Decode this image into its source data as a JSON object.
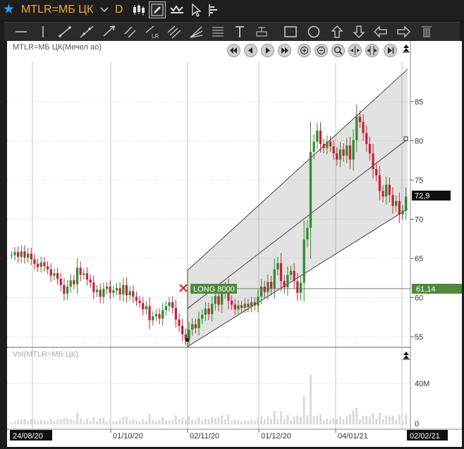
{
  "toolbar": {
    "symbol": "MTLR=МБ ЦК",
    "timeframe": "D"
  },
  "chart_header": {
    "price_title": "MTLR=МБ ЦК(Мечел ао)",
    "volume_title": "Vol(MTLR=МБ ЦК)"
  },
  "price_axis": {
    "ticks": [
      "85",
      "80",
      "75",
      "70",
      "65",
      "60",
      "55"
    ],
    "last_price_label": "72,9",
    "order_price_label": "61,14"
  },
  "volume_axis": {
    "ticks": [
      "40M",
      "0"
    ]
  },
  "order": {
    "label": "LONG 8000"
  },
  "date_axis": {
    "start_label": "24/08/20",
    "ticks": [
      "01/10/20",
      "02/11/20",
      "01/12/20",
      "04/01/21"
    ],
    "end_label": "02/02/21"
  },
  "colors": {
    "up": "#2e8b2e",
    "down": "#c8203a",
    "accent": "#f0a838",
    "star": "#2d9cf0",
    "order_label": "#4f8a3a"
  },
  "chart_data": {
    "type": "candlestick",
    "x_range": [
      "24/08/20",
      "02/02/21"
    ],
    "ylim": [
      53,
      91
    ],
    "price_ticks": [
      85,
      80,
      75,
      70,
      65,
      60,
      55
    ],
    "last_price": 72.9,
    "order_price": 61.14,
    "volume_ticks": [
      "40M",
      "0"
    ],
    "grid": true,
    "closes": [
      65.4,
      65.8,
      65.2,
      65.9,
      65.1,
      65.6,
      64.9,
      64.3,
      63.9,
      64.5,
      64.0,
      63.6,
      62.8,
      63.1,
      62.4,
      61.6,
      60.5,
      61.4,
      62.2,
      61.7,
      63.8,
      62.9,
      63.1,
      62.3,
      61.9,
      60.7,
      61.0,
      60.1,
      61.1,
      61.4,
      60.6,
      60.9,
      61.2,
      60.4,
      61.6,
      60.3,
      60.8,
      60.1,
      59.6,
      59.3,
      58.5,
      58.9,
      57.1,
      57.6,
      57.9,
      57.3,
      58.4,
      58.9,
      59.4,
      58.7,
      57.2,
      56.4,
      55.3,
      54.6,
      55.9,
      56.6,
      56.1,
      57.3,
      57.8,
      58.6,
      57.9,
      59.2,
      60.2,
      59.1,
      60.6,
      61.3,
      59.6,
      59.1,
      58.5,
      59.0,
      58.7,
      59.2,
      58.8,
      59.4,
      59.0,
      60.1,
      61.4,
      60.7,
      62.0,
      61.2,
      63.6,
      64.4,
      62.1,
      61.3,
      62.9,
      63.4,
      62.1,
      60.6,
      61.9,
      67.4,
      68.9,
      78.6,
      79.9,
      81.3,
      79.6,
      79.1,
      79.9,
      79.3,
      78.4,
      77.6,
      78.9,
      78.1,
      79.4,
      77.6,
      80.1,
      83.1,
      82.4,
      81.0,
      79.6,
      78.4,
      76.4,
      75.6,
      73.6,
      72.9,
      74.4,
      73.1,
      71.7,
      72.3,
      70.6,
      71.1,
      72.9
    ]
  }
}
